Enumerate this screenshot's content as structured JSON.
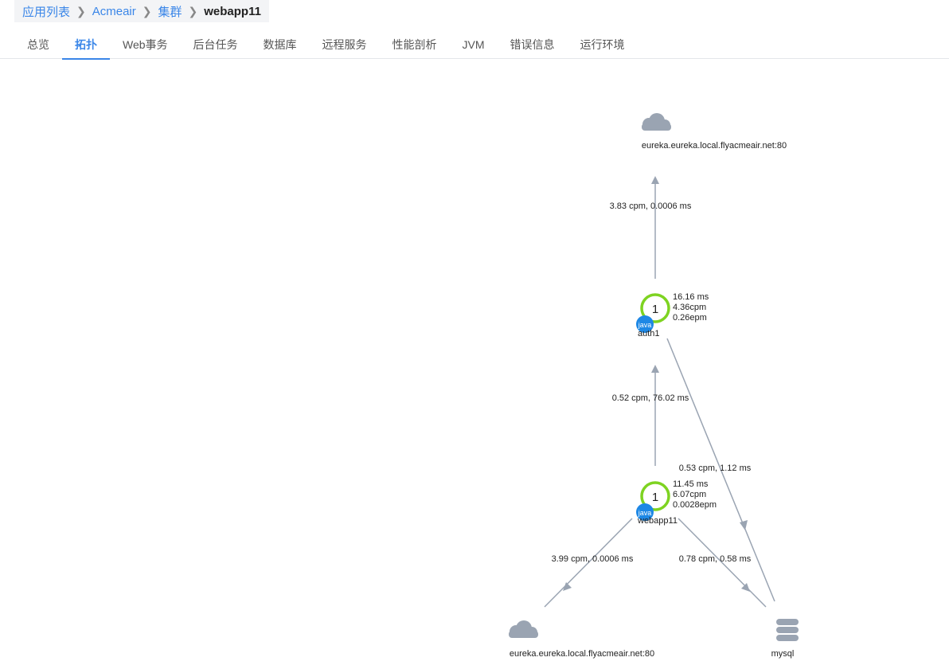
{
  "breadcrumb": [
    {
      "label": "应用列表"
    },
    {
      "label": "Acmeair"
    },
    {
      "label": "集群"
    },
    {
      "label": "webapp11"
    }
  ],
  "tabs": [
    {
      "label": "总览"
    },
    {
      "label": "拓扑"
    },
    {
      "label": "Web事务"
    },
    {
      "label": "后台任务"
    },
    {
      "label": "数据库"
    },
    {
      "label": "远程服务"
    },
    {
      "label": "性能剖析"
    },
    {
      "label": "JVM"
    },
    {
      "label": "错误信息"
    },
    {
      "label": "运行环境"
    }
  ],
  "active_tab": "拓扑",
  "colors": {
    "accent": "#3a86e8",
    "node_ring": "#7ed321",
    "java_badge": "#1e88e5",
    "edge": "#9aa4b2",
    "icon": "#9aa4b2"
  },
  "topology": {
    "nodes": {
      "eureka_top": {
        "label": "eureka.eureka.local.flyacmeair.net:80",
        "icon": "cloud-icon"
      },
      "auth1": {
        "label": "auth1",
        "instances": "1",
        "badge": "java",
        "metrics": [
          "16.16 ms",
          "4.36cpm",
          "0.26epm"
        ]
      },
      "webapp11": {
        "label": "webapp11",
        "instances": "1",
        "badge": "java",
        "metrics": [
          "11.45 ms",
          "6.07cpm",
          "0.0028epm"
        ]
      },
      "eureka_bottom": {
        "label": "eureka.eureka.local.flyacmeair.net:80",
        "icon": "cloud-icon"
      },
      "mysql": {
        "label": "mysql",
        "icon": "database-icon"
      }
    },
    "edges": {
      "auth1_to_eureka": "3.83 cpm, 0.0006 ms",
      "webapp_to_auth1": "0.52 cpm, 76.02 ms",
      "auth1_to_mysql": "0.53 cpm, 1.12 ms",
      "webapp_to_eureka": "3.99 cpm, 0.0006 ms",
      "webapp_to_mysql": "0.78 cpm, 0.58 ms"
    }
  }
}
